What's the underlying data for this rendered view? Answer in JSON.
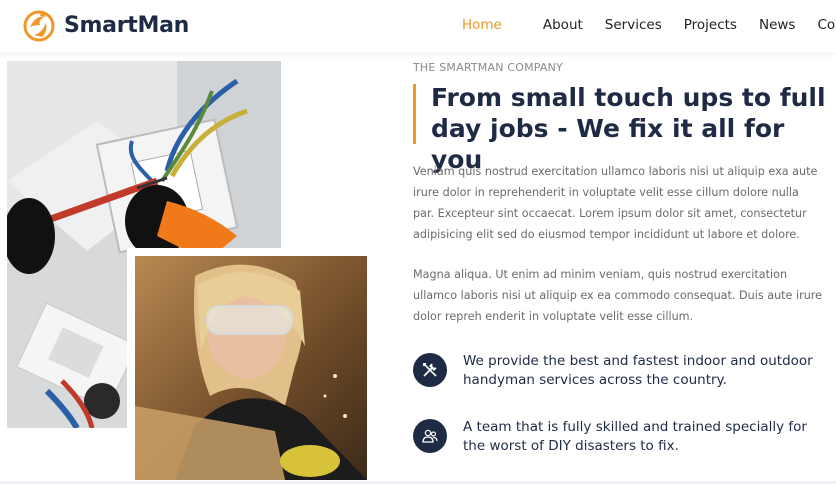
{
  "brand": {
    "name": "SmartMan",
    "accent": "#f0972a",
    "dark": "#1f2a44"
  },
  "nav": {
    "items": [
      {
        "label": "Home",
        "active": true
      },
      {
        "label": "About",
        "active": false
      },
      {
        "label": "Services",
        "active": false
      },
      {
        "label": "Projects",
        "active": false
      },
      {
        "label": "News",
        "active": false
      },
      {
        "label": "Contact",
        "active": false
      }
    ]
  },
  "about": {
    "eyebrow": "THE SMARTMAN COMPANY",
    "heading": "From small touch ups to full day jobs - We fix it all for you",
    "paragraph1": "Veniam quis nostrud exercitation ullamco laboris nisi ut aliquip exa aute irure dolor in reprehenderit in voluptate velit esse cillum dolore nulla par. Excepteur sint occaecat. Lorem ipsum dolor sit amet, consectetur adipisicing elit sed do eiusmod tempor incididunt ut labore et dolore.",
    "paragraph2": "Magna aliqua. Ut enim ad minim veniam, quis nostrud exercitation ullamco laboris nisi ut aliquip ex ea commodo consequat. Duis aute irure dolor repreh enderit in voluptate velit esse cillum.",
    "features": [
      {
        "icon": "tools-icon",
        "text": "We provide the best and fastest indoor and outdoor handyman services across the country."
      },
      {
        "icon": "team-icon",
        "text": "A team that is fully skilled and trained specially for the worst of DIY disasters to fix."
      }
    ]
  },
  "images": {
    "photo1": "electrician-wiring-photo",
    "photo2": "woman-with-safety-goggles-photo"
  }
}
